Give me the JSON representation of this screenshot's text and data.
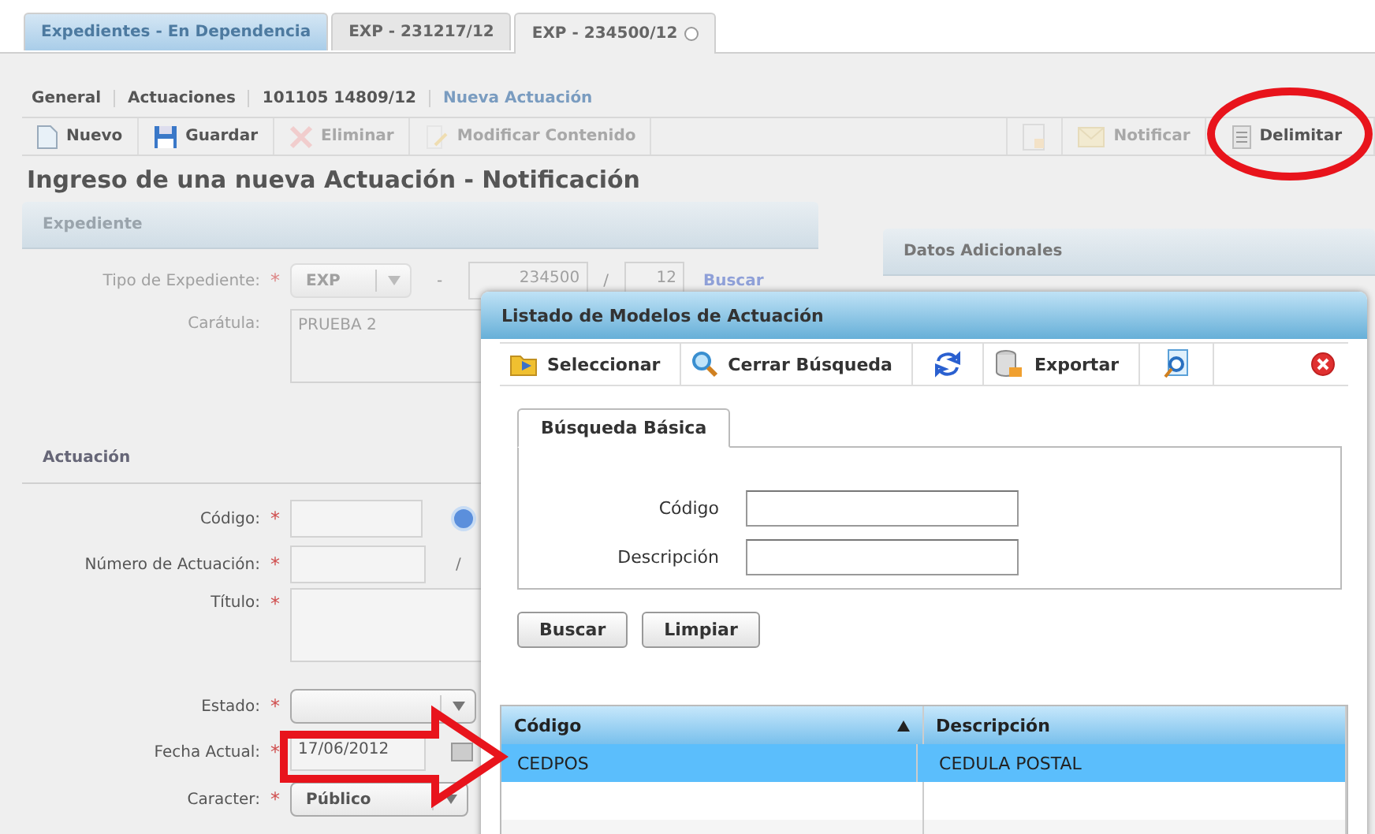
{
  "tabs": [
    {
      "label": "Expedientes - En Dependencia",
      "selected": false,
      "closable": false
    },
    {
      "label": "EXP - 231217/12",
      "selected": false,
      "closable": false
    },
    {
      "label": "EXP - 234500/12",
      "selected": true,
      "closable": true
    }
  ],
  "breadcrumb": [
    {
      "label": "General",
      "kind": "item"
    },
    {
      "label": "Actuaciones",
      "kind": "item"
    },
    {
      "label": "101105 14809/12",
      "kind": "item"
    },
    {
      "label": "Nueva Actuación",
      "kind": "link"
    }
  ],
  "toolbar": [
    {
      "label": "Nuevo",
      "disabled": false
    },
    {
      "label": "Guardar",
      "disabled": false
    },
    {
      "label": "Eliminar",
      "disabled": true
    },
    {
      "label": "Modificar Contenido",
      "disabled": true
    },
    {
      "disabled": true
    },
    {
      "label": "Notificar",
      "disabled": true
    },
    {
      "label": "Delimitar",
      "disabled": false
    }
  ],
  "heading": "Ingreso de una nueva Actuación - Notificación",
  "expediente": {
    "title": "Expediente",
    "tipo_label": "Tipo de Expediente:",
    "tipo_marker": "*",
    "tipo_value": "EXP",
    "separator": "-",
    "numero": "234500",
    "slash": "/",
    "anio": "12",
    "buscar": "Buscar",
    "caratula_label": "Carátula:",
    "caratula_value": "PRUEBA 2"
  },
  "actuacion": {
    "title": "Actuación",
    "fields": [
      {
        "label": "Código:",
        "marker": "*",
        "kind": "help"
      },
      {
        "label": "Número de Actuación:",
        "marker": "*",
        "kind": "number",
        "suffix": "/"
      },
      {
        "label": "Título:",
        "marker": "*",
        "kind": "textarea"
      },
      {
        "label": "Estado:",
        "marker": "*",
        "kind": "select"
      },
      {
        "label": "Fecha Actual:",
        "marker": "*",
        "kind": "date",
        "value": "17/06/2012"
      },
      {
        "label": "Caracter:",
        "marker": "*",
        "kind": "select",
        "value": "Público"
      }
    ]
  },
  "datos_adicionales": {
    "title": "Datos Adicionales"
  },
  "dialog": {
    "title": "Listado de Modelos de Actuación",
    "toolbar": [
      {
        "kind": "text",
        "label": "Seleccionar"
      },
      {
        "kind": "text",
        "label": "Cerrar Búsqueda"
      },
      {
        "kind": "icon"
      },
      {
        "kind": "text",
        "label": "Exportar"
      },
      {
        "kind": "icon"
      }
    ],
    "tabs": [
      {
        "label": "Búsqueda Básica",
        "selected": true
      }
    ],
    "fields": [
      {
        "label": "Código"
      },
      {
        "label": "Descripción"
      }
    ],
    "buttons": [
      "Buscar",
      "Limpiar"
    ],
    "table": {
      "columns": [
        {
          "label": "Código",
          "sorted": true
        },
        {
          "label": "Descripción",
          "sorted": false
        }
      ],
      "rows": [
        {
          "cells": [
            "CEDPOS",
            "CEDULA POSTAL"
          ],
          "selected": true
        }
      ]
    }
  }
}
